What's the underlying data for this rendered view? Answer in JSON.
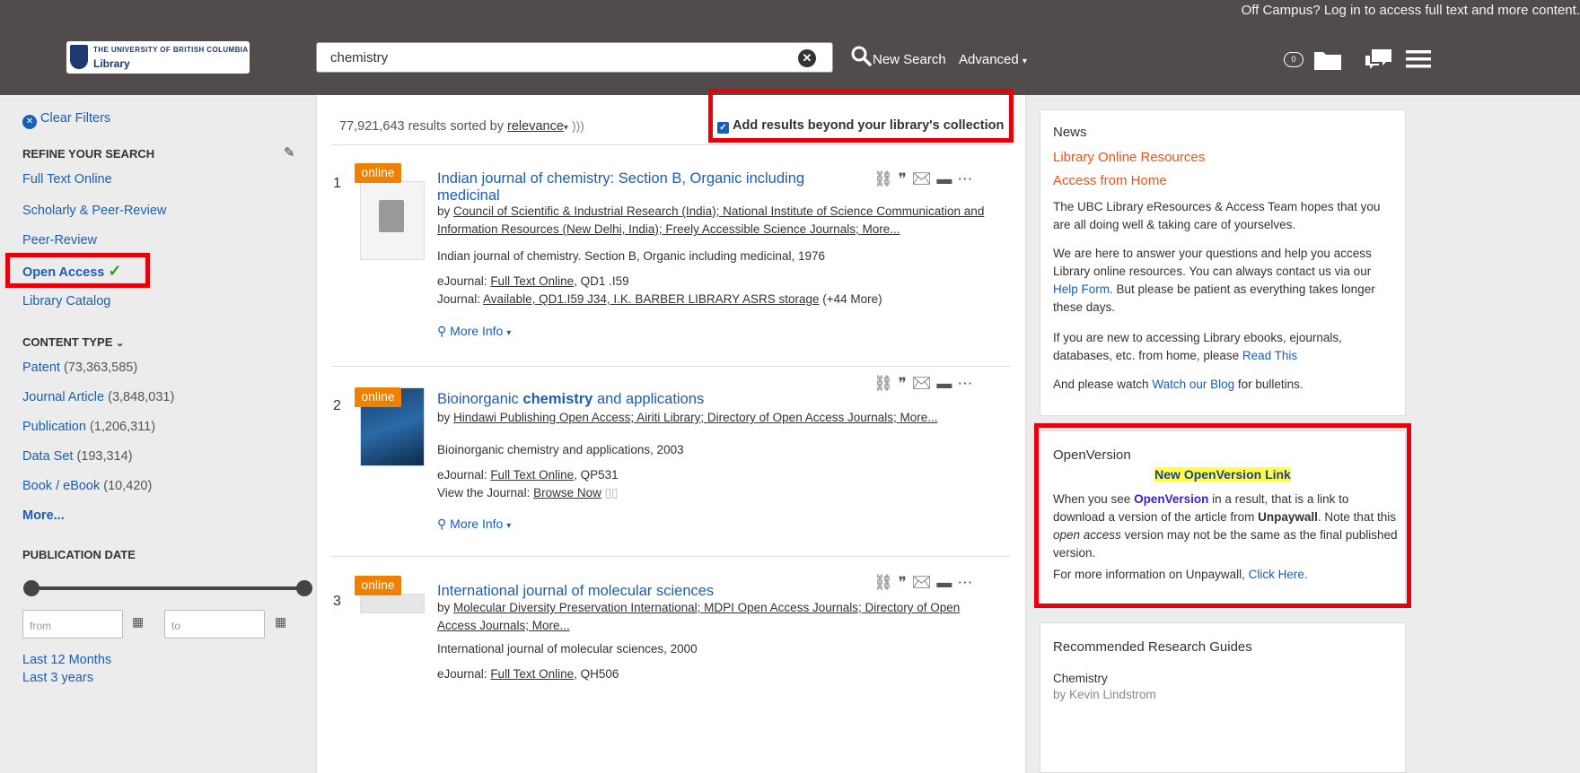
{
  "top_message": "Off Campus? Log in to access full text and more content.",
  "logo": {
    "line1": "THE UNIVERSITY OF BRITISH COLUMBIA",
    "line2": "Library"
  },
  "search": {
    "value": "chemistry",
    "new_search": "New Search",
    "advanced": "Advanced"
  },
  "cart_count": "0",
  "sidebar": {
    "clear_filters": "Clear Filters",
    "refine_heading": "REFINE YOUR SEARCH",
    "refine_items": [
      "Full Text Online",
      "Scholarly & Peer-Review",
      "Peer-Review",
      "Open Access",
      "Library Catalog"
    ],
    "content_type_heading": "CONTENT TYPE",
    "content_types": [
      {
        "label": "Patent",
        "count": "(73,363,585)"
      },
      {
        "label": "Journal Article",
        "count": "(3,848,031)"
      },
      {
        "label": "Publication",
        "count": "(1,206,311)"
      },
      {
        "label": "Data Set",
        "count": "(193,314)"
      },
      {
        "label": "Book / eBook",
        "count": "(10,420)"
      }
    ],
    "more": "More...",
    "pub_date_heading": "PUBLICATION DATE",
    "from_placeholder": "from",
    "to_placeholder": "to",
    "last_12": "Last 12 Months",
    "last_3": "Last 3 years"
  },
  "results": {
    "summary": "77,921,643 results sorted by",
    "sort": "relevance",
    "beyond": "Add results beyond your library's collection",
    "items": [
      {
        "num": "1",
        "tag": "online",
        "title": "Indian journal of chemistry: Section B, Organic including medicinal",
        "by_prefix": "by",
        "authors": "Council of Scientific & Industrial Research (India); National Institute of Science Communication and Information Resources (New Delhi, India); Freely Accessible Science Journals; More...",
        "desc": "Indian journal of chemistry. Section B, Organic including medicinal, 1976",
        "line_a_label": "eJournal:",
        "line_a_link": "Full Text Online",
        "line_a_rest": ", QD1 .I59",
        "line_b_label": "Journal:",
        "line_b_link": "Available, QD1.I59 J34, I.K. BARBER LIBRARY ASRS storage",
        "line_b_rest": "(+44 More)",
        "more_info": "More Info"
      },
      {
        "num": "2",
        "tag": "online",
        "title_pre": "Bioinorganic ",
        "title_bold": "chemistry",
        "title_post": " and applications",
        "by_prefix": "by",
        "authors": "Hindawi Publishing Open Access; Airiti Library; Directory of Open Access Journals; More...",
        "desc": "Bioinorganic chemistry and applications, 2003",
        "line_a_label": "eJournal:",
        "line_a_link": "Full Text Online",
        "line_a_rest": ", QP531",
        "line_b_label": "View the Journal:",
        "line_b_link": "Browse Now",
        "more_info": "More Info"
      },
      {
        "num": "3",
        "tag": "online",
        "title": "International journal of molecular sciences",
        "by_prefix": "by",
        "authors": "Molecular Diversity Preservation International; MDPI Open Access Journals; Directory of Open Access Journals; More...",
        "desc": "International journal of molecular sciences, 2000",
        "line_a_label": "eJournal:",
        "line_a_link": "Full Text Online",
        "line_a_rest": ", QH506"
      }
    ]
  },
  "news": {
    "heading": "News",
    "sub1": "Library Online Resources",
    "sub2": "Access from Home",
    "p1": "The UBC Library eResources & Access Team hopes that you are all doing well & taking care of yourselves.",
    "p2_pre": "We are here to answer your questions and help you access Library online resources. You can always contact us via our ",
    "p2_link": "Help Form",
    "p2_post": ". But please be patient as everything takes longer these days.",
    "p3_pre": "If you are new to accessing Library ebooks, ejournals, databases, etc. from home, please ",
    "p3_link": "Read This",
    "p4_pre": "And please watch ",
    "p4_link": "Watch our Blog",
    "p4_post": " for bulletins."
  },
  "openversion": {
    "heading": "OpenVersion",
    "link": "New OpenVersion Link",
    "p_pre": "When you see ",
    "p_b1": "OpenVersion",
    "p_mid1": " in a result, that is a link to download a version of the article from ",
    "p_b2": "Unpaywall",
    "p_mid2": ". Note that this ",
    "p_i": "open access",
    "p_post": " version may not be the same as the final published version.",
    "p2_pre": "For more information on Unpaywall, ",
    "p2_link": "Click Here",
    "p2_post": "."
  },
  "guides": {
    "heading": "Recommended Research Guides",
    "item": "Chemistry",
    "by": "by Kevin Lindstrom"
  }
}
